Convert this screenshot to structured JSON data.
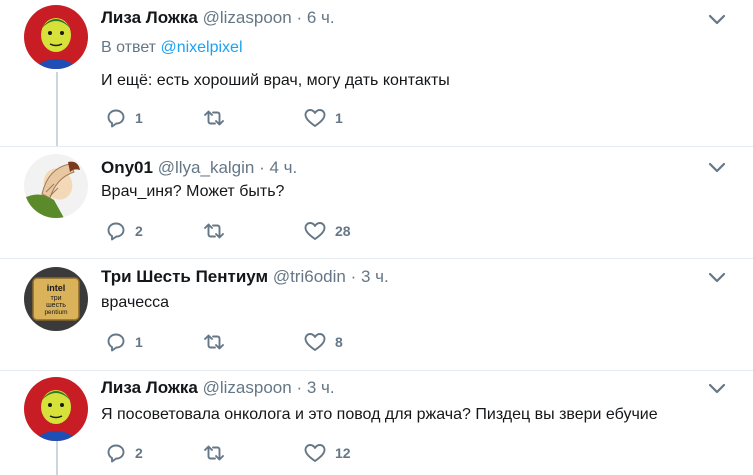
{
  "tweets": [
    {
      "name": "Лиза Ложка",
      "handle": "@lizaspoon",
      "dot": "·",
      "time": "6 ч.",
      "reply_prefix": "В ответ ",
      "reply_mention": "@nixelpixel",
      "text": "И ещё: есть хороший врач, могу дать контакты",
      "replies": "1",
      "retweets": "",
      "likes": "1",
      "avatar": "yellow-face-avatar"
    },
    {
      "name": "Ony01",
      "handle": "@llya_kalgin",
      "dot": "·",
      "time": "4 ч.",
      "text": "Врач_иня? Может быть?",
      "replies": "2",
      "retweets": "",
      "likes": "28",
      "avatar": "facepalm-avatar"
    },
    {
      "name": "Три Шесть Пентиум",
      "handle": "@tri6odin",
      "dot": "·",
      "time": "3 ч.",
      "text": "врачесса",
      "replies": "1",
      "retweets": "",
      "likes": "8",
      "avatar": "intel-pentium-avatar",
      "avatar_text": [
        "intel",
        "три",
        "шесть",
        "pentium"
      ]
    },
    {
      "name": "Лиза Ложка",
      "handle": "@lizaspoon",
      "dot": "·",
      "time": "3 ч.",
      "text": "Я посоветовала онколога и это повод для ржача? Пиздец вы звери ебучие",
      "replies": "2",
      "retweets": "",
      "likes": "12",
      "avatar": "yellow-face-avatar"
    }
  ],
  "colors": {
    "accent": "#1da1f2",
    "secondary_text": "#657786",
    "thread_line": "#ccd6dd",
    "divider": "#e6ecf0"
  }
}
